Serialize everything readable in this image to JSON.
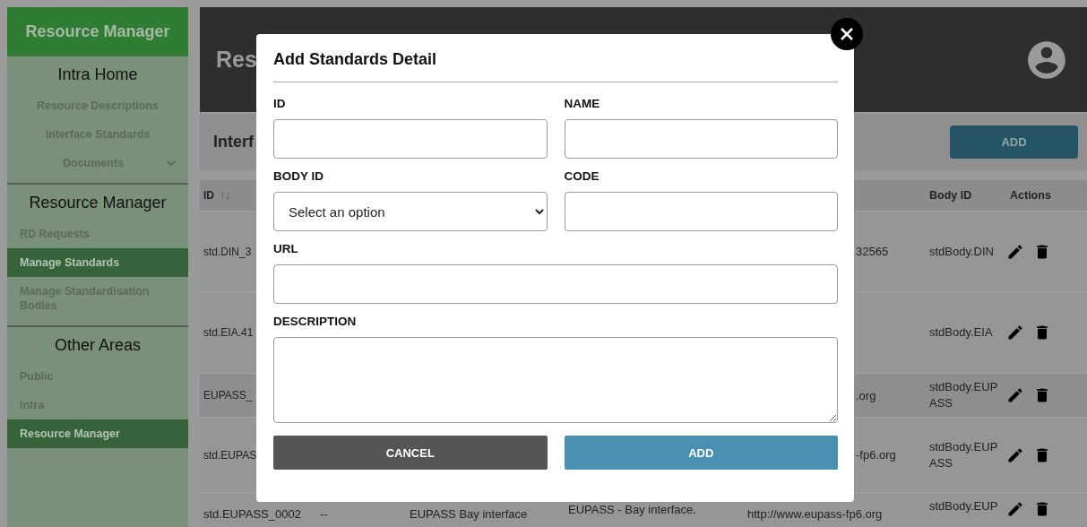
{
  "sidebar": {
    "brand": "Resource Manager",
    "sections": [
      {
        "title": "Intra Home",
        "centered": true,
        "items": [
          {
            "label": "Resource Descriptions",
            "kind": "link",
            "selected": false
          },
          {
            "label": "Interface Standards",
            "kind": "link",
            "selected": false
          },
          {
            "label": "Documents",
            "kind": "dropdown",
            "selected": false
          }
        ]
      },
      {
        "title": "Resource Manager",
        "centered": false,
        "items": [
          {
            "label": "RD Requests",
            "kind": "link",
            "selected": false
          },
          {
            "label": "Manage Standards",
            "kind": "link",
            "selected": true
          },
          {
            "label": "Manage Standardisation Bodies",
            "kind": "link",
            "selected": false
          }
        ]
      },
      {
        "title": "Other Areas",
        "centered": false,
        "items": [
          {
            "label": "Public",
            "kind": "link",
            "selected": false
          },
          {
            "label": "Intra",
            "kind": "link",
            "selected": false
          },
          {
            "label": "Resource Manager",
            "kind": "link",
            "selected": true
          }
        ]
      }
    ]
  },
  "header": {
    "title": "Res"
  },
  "toolbar": {
    "title": "Interf",
    "add_button": "ADD"
  },
  "table": {
    "columns": [
      {
        "label": "ID",
        "sort_icon": "↑↓"
      },
      {
        "label": "Body ID"
      },
      {
        "label": "Actions"
      }
    ],
    "rows": [
      {
        "id": "std.DIN_3",
        "url": "32565",
        "body_id": "stdBody.DIN"
      },
      {
        "id": "std.EIA.41",
        "url": "",
        "body_id": "stdBody.EIA"
      },
      {
        "id": "EUPASS_",
        "url": ".org",
        "body_id": "stdBody.EUPASS"
      },
      {
        "id": "std.EUPAS",
        "url": "-fp6.org",
        "body_id": "stdBody.EUPASS"
      }
    ],
    "last_row": {
      "id": "std.EUPASS_0002",
      "code": "--",
      "name": "EUPASS Bay interface",
      "description": "EUPASS - Bay interface.",
      "url": "http://www.eupass-fp6.org",
      "body_id": "stdBody.EUP"
    }
  },
  "modal": {
    "title": "Add Standards Detail",
    "fields": [
      {
        "label": "ID",
        "kind": "text",
        "full_width": false
      },
      {
        "label": "NAME",
        "kind": "text",
        "full_width": false
      },
      {
        "label": "BODY ID",
        "kind": "select",
        "placeholder": "Select an option",
        "full_width": false
      },
      {
        "label": "CODE",
        "kind": "text",
        "full_width": false
      },
      {
        "label": "URL",
        "kind": "text",
        "full_width": true
      },
      {
        "label": "DESCRIPTION",
        "kind": "textarea",
        "full_width": true
      }
    ],
    "cancel_button": "CANCEL",
    "add_button": "ADD"
  }
}
